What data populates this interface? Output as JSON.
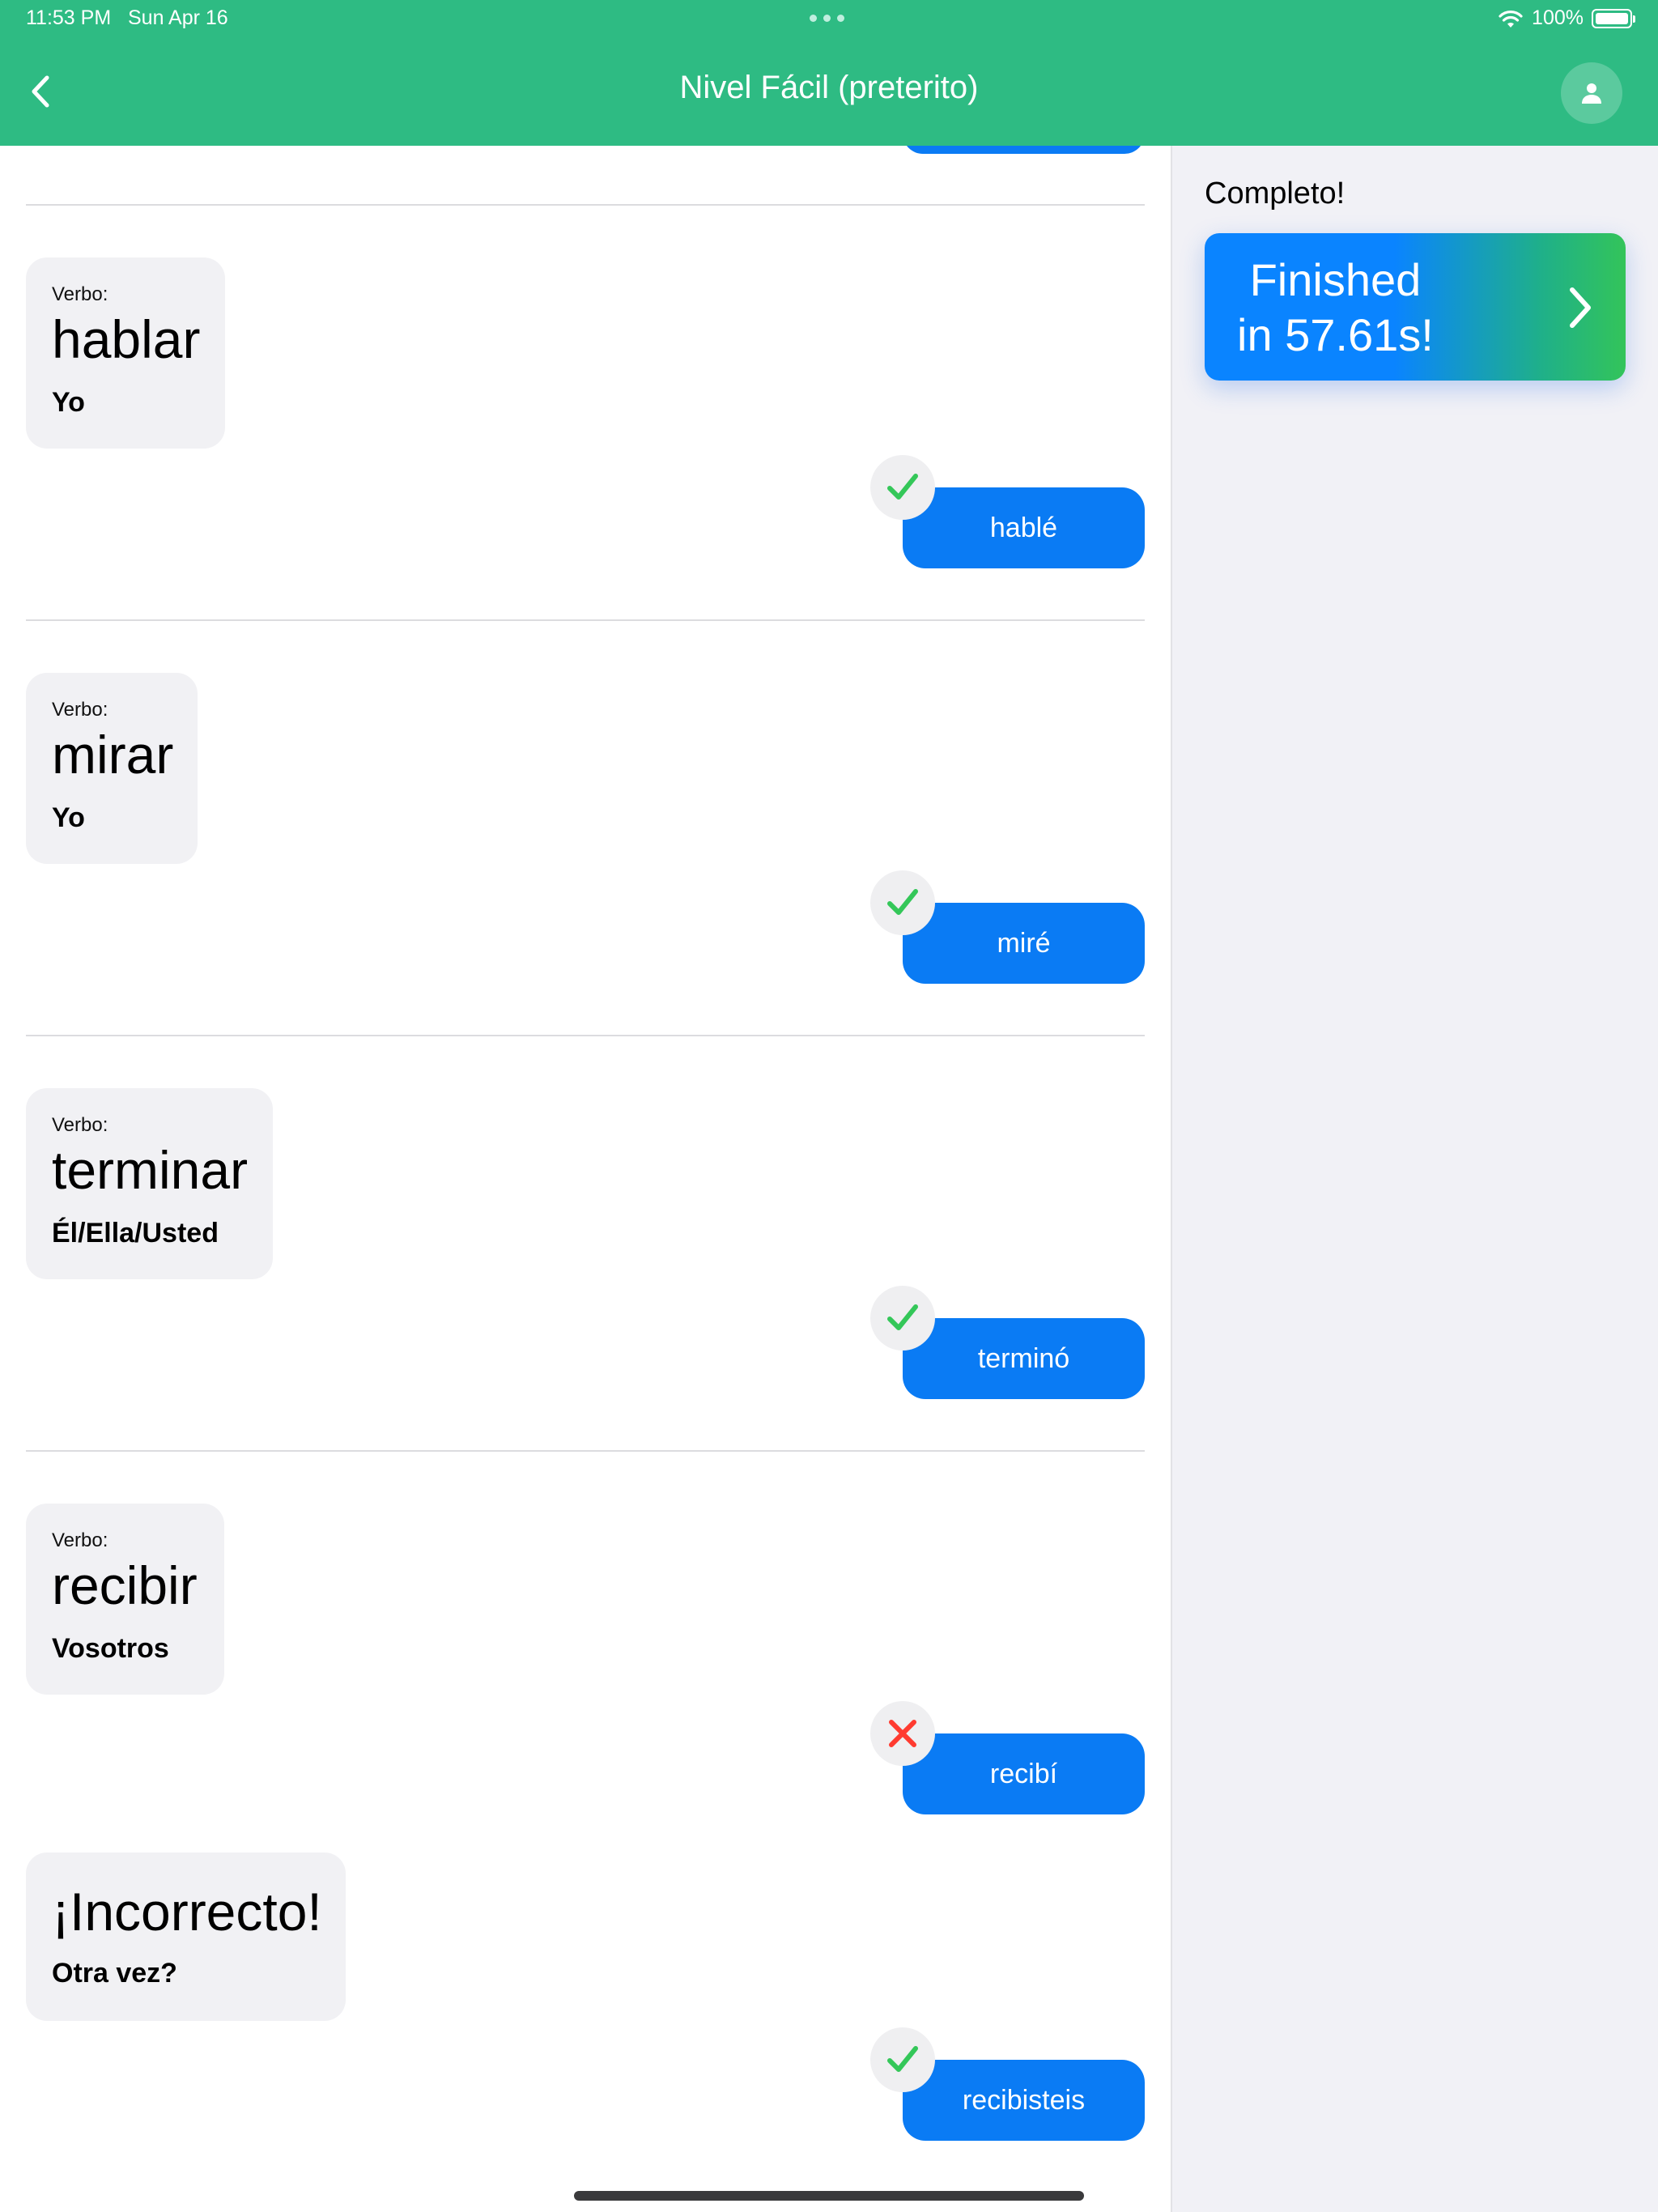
{
  "status_bar": {
    "time": "11:53 PM",
    "date": "Sun Apr 16",
    "battery": "100%"
  },
  "nav": {
    "title": "Nivel Fácil (preterito)",
    "back_icon": "chevron-left-icon",
    "profile_icon": "person-icon"
  },
  "colors": {
    "header": "#2ebb83",
    "answer": "#0a7bf4",
    "correct": "#34c759",
    "incorrect": "#ff3b30",
    "card": "#f1f1f4"
  },
  "items": [
    {
      "label": "Verbo:",
      "verb": "hablar",
      "subject": "Yo",
      "answer": "hablé",
      "result": "correct"
    },
    {
      "label": "Verbo:",
      "verb": "mirar",
      "subject": "Yo",
      "answer": "miré",
      "result": "correct"
    },
    {
      "label": "Verbo:",
      "verb": "terminar",
      "subject": "Él/Ella/Usted",
      "answer": "terminó",
      "result": "correct"
    },
    {
      "label": "Verbo:",
      "verb": "recibir",
      "subject": "Vosotros",
      "answer": "recibí",
      "result": "incorrect"
    }
  ],
  "retry": {
    "title": "¡Incorrecto!",
    "prompt": "Otra vez?",
    "answer": "recibisteis",
    "result": "correct"
  },
  "sidebar": {
    "title": "Completo!",
    "finish_line1": "Finished",
    "finish_line2": "in 57.61s!"
  }
}
